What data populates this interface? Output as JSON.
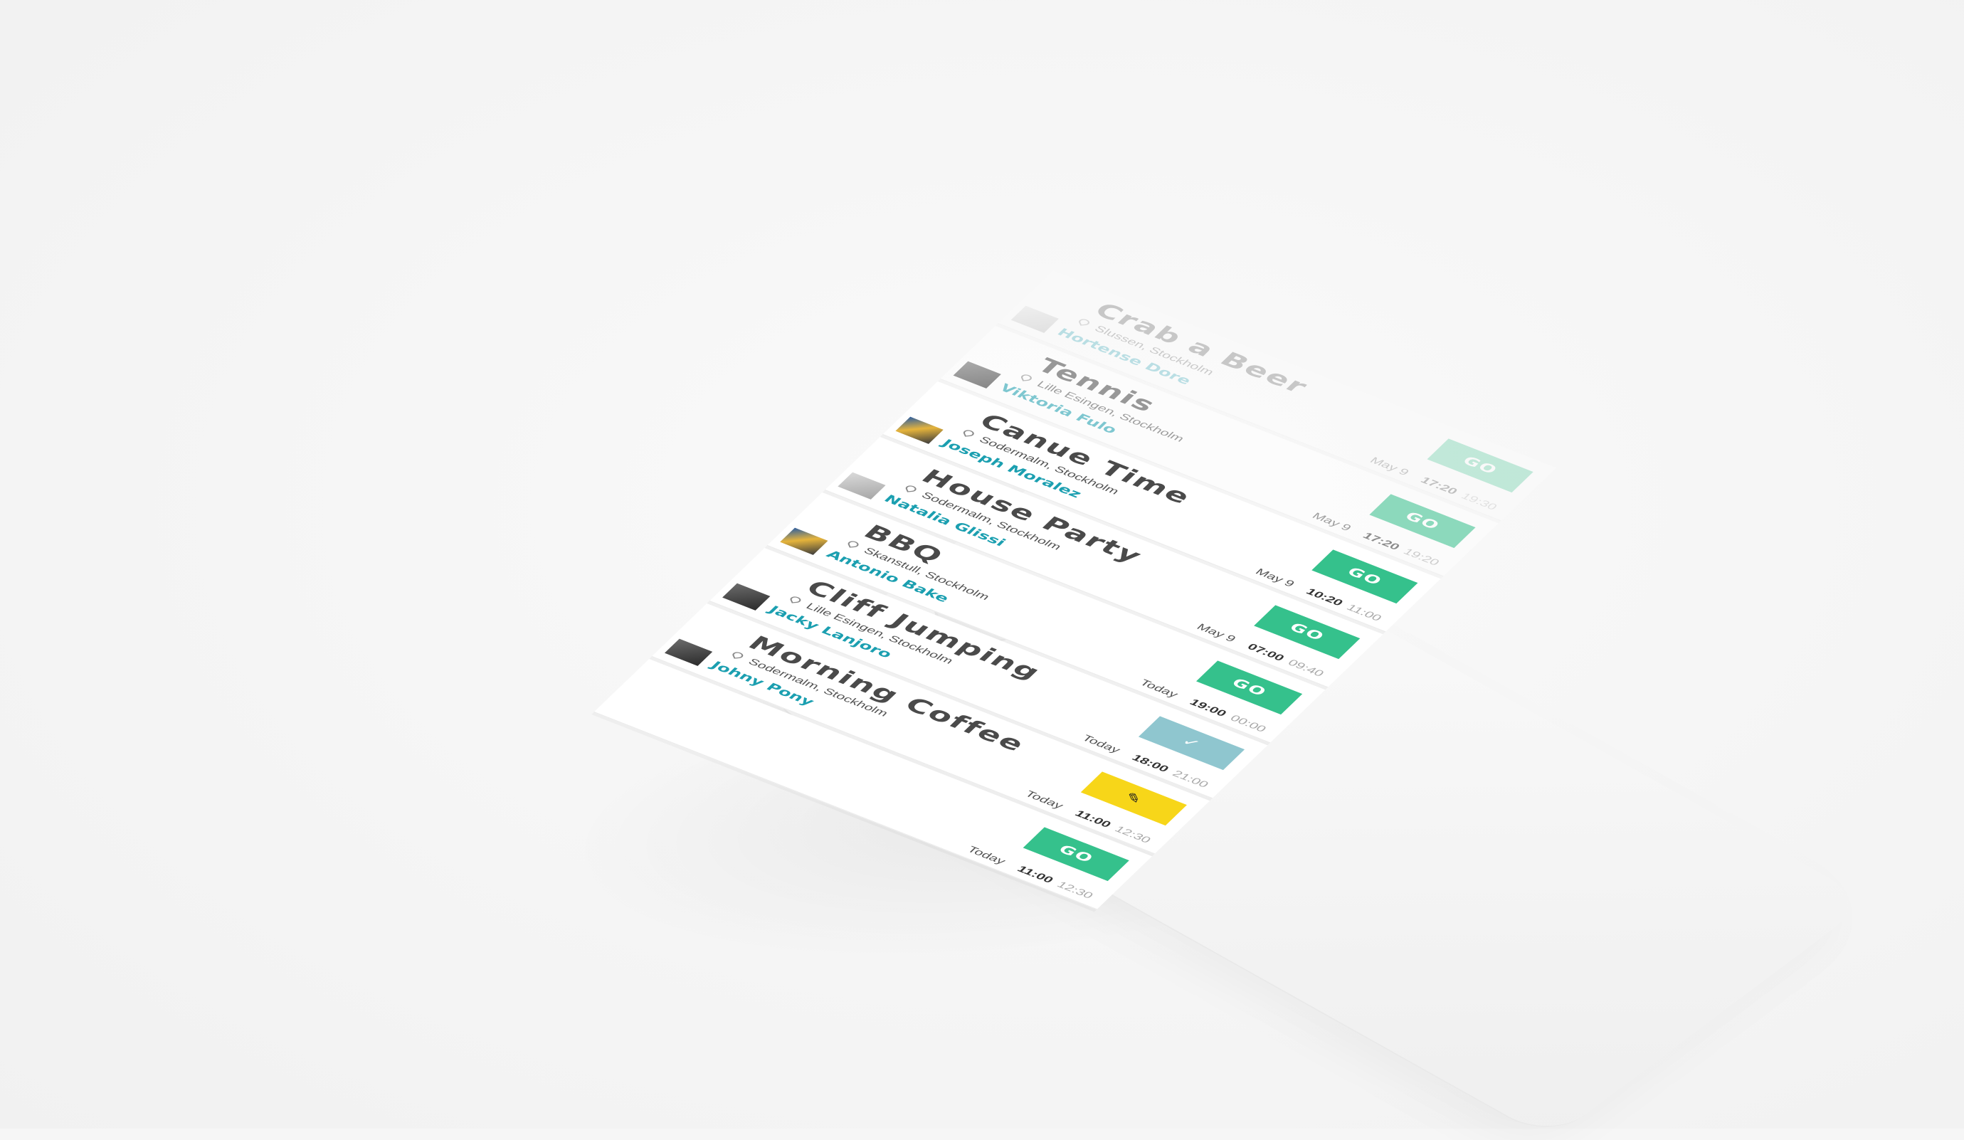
{
  "events": [
    {
      "title": "Crab a Beer",
      "location": "Slussen, Stockholm",
      "host": "Hortense Dore",
      "day": "May 9",
      "start": "17:20",
      "end": "19:30",
      "action": "GO",
      "action_type": "go"
    },
    {
      "title": "Tennis",
      "location": "Lille Esingen, Stockholm",
      "host": "Viktoria Fulo",
      "day": "May 9",
      "start": "17:20",
      "end": "19:20",
      "action": "GO",
      "action_type": "go"
    },
    {
      "title": "Canue Time",
      "location": "Sodermalm, Stockholm",
      "host": "Joseph Moralez",
      "day": "May 9",
      "start": "10:20",
      "end": "11:00",
      "action": "GO",
      "action_type": "go"
    },
    {
      "title": "House Party",
      "location": "Sodermalm, Stockholm",
      "host": "Natalia Glissi",
      "day": "May 9",
      "start": "07:00",
      "end": "09:40",
      "action": "GO",
      "action_type": "go"
    },
    {
      "title": "BBQ",
      "location": "Skanstull, Stockholm",
      "host": "Antonio Bake",
      "day": "Today",
      "start": "19:00",
      "end": "00:00",
      "action": "GO",
      "action_type": "go"
    },
    {
      "title": "Cliff Jumping",
      "location": "Lille Esingen, Stockholm",
      "host": "Jacky Lanjoro",
      "day": "Today",
      "start": "18:00",
      "end": "21:00",
      "action": "✓",
      "action_type": "checked"
    },
    {
      "title": "Morning Coffee",
      "location": "Sodermalm, Stockholm",
      "host": "Johny Pony",
      "day": "Today",
      "start": "11:00",
      "end": "12:30",
      "action": "✎",
      "action_type": "edit"
    },
    {
      "title": "",
      "location": "",
      "host": "",
      "day": "Today",
      "start": "11:00",
      "end": "12:30",
      "action": "GO",
      "action_type": "go"
    }
  ],
  "colors": {
    "go": "#35c18c",
    "checked": "#8fc6cf",
    "edit": "#f7d619",
    "host_link": "#1b9fb0"
  }
}
